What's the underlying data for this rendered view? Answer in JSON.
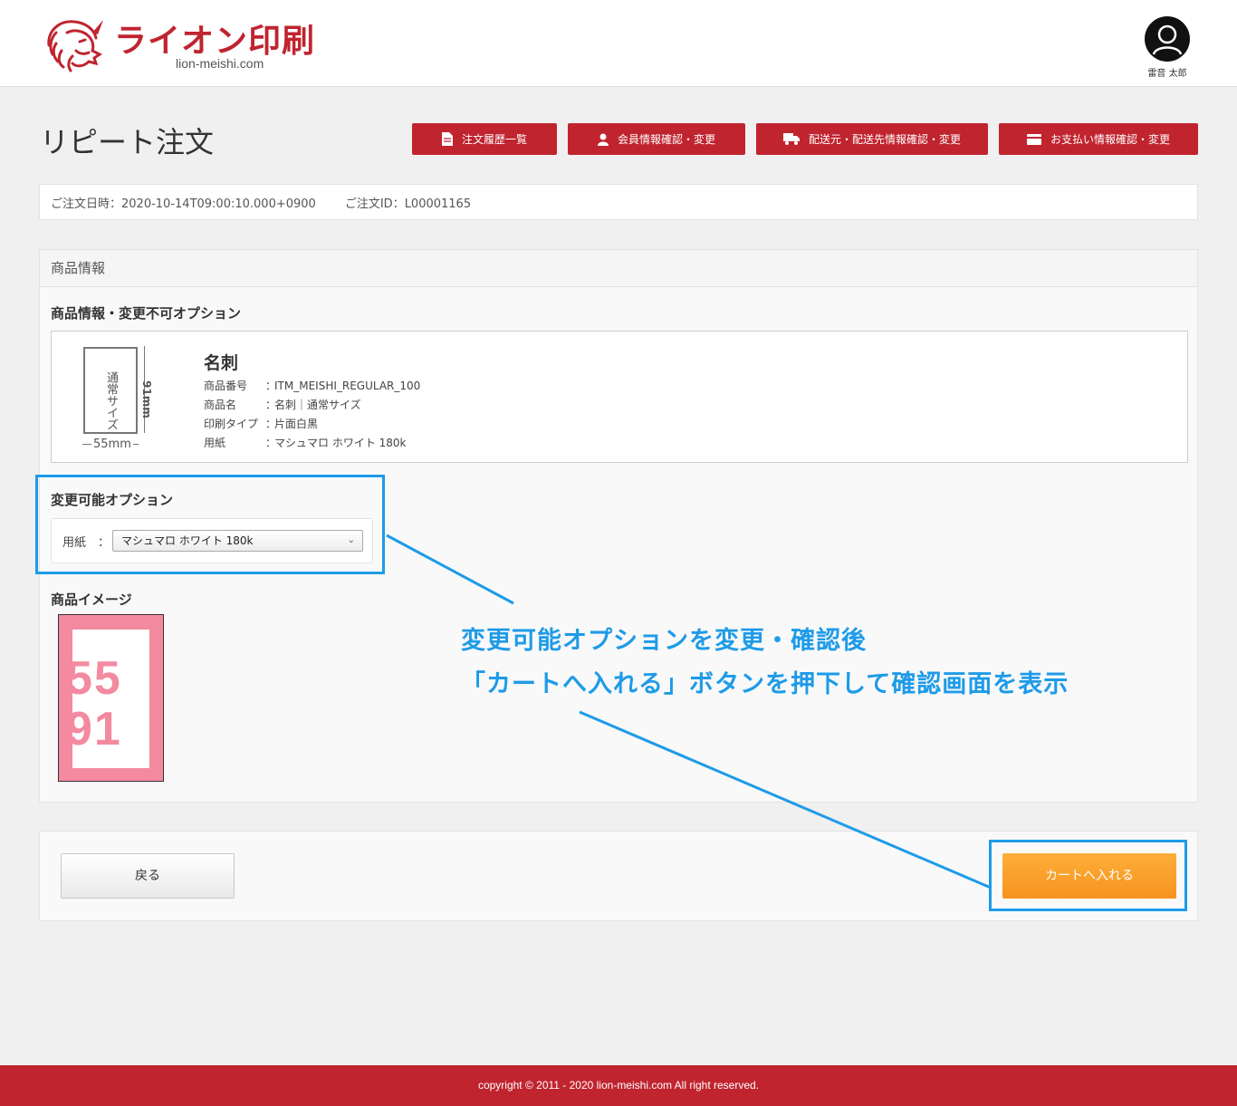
{
  "header": {
    "logo_title": "ライオン印刷",
    "logo_sub": "lion-meishi.com",
    "user_name": "雷音 太郎"
  },
  "page": {
    "title": "リピート注文"
  },
  "nav": {
    "order_history": "注文履歴一覧",
    "member_info": "会員情報確認・変更",
    "shipping_info": "配送元・配送先情報確認・変更",
    "payment_info": "お支払い情報確認・変更"
  },
  "order": {
    "date_label": "ご注文日時：",
    "date_value": "2020-10-14T09:00:10.000+0900",
    "id_label": "ご注文ID：",
    "id_value": "L00001165"
  },
  "product_panel": {
    "heading": "商品情報",
    "fixed_title": "商品情報・変更不可オプション",
    "card_label": "通常サイズ",
    "height_label": "91mm",
    "width_label": "55mm",
    "name": "名刺",
    "specs": [
      {
        "key": "商品番号",
        "sep": "：",
        "value": "ITM_MEISHI_REGULAR_100"
      },
      {
        "key": "商品名",
        "sep": "：",
        "value": "名刺｜通常サイズ"
      },
      {
        "key": "印刷タイプ",
        "sep": "：",
        "value": "片面白黒"
      },
      {
        "key": "用紙",
        "sep": "：",
        "value": "マシュマロ ホワイト 180k"
      }
    ],
    "changeable_title": "変更可能オプション",
    "option_label": "用紙　：",
    "option_selected": "マシュマロ ホワイト 180k",
    "image_title": "商品イメージ",
    "image_num_top": "55",
    "image_num_bottom": "91"
  },
  "actions": {
    "back": "戻る",
    "cart": "カートへ入れる"
  },
  "annotation": {
    "line1": "変更可能オプションを変更・確認後",
    "line2": "「カートへ入れる」ボタンを押下して確認画面を表示"
  },
  "footer": {
    "copyright": "copyright © 2011 - 2020 lion-meishi.com All right reserved."
  },
  "colors": {
    "brand": "#c0242f",
    "accent_orange": "#f7931e",
    "annotation_blue": "#1e9be8",
    "image_pink": "#f38aa0"
  }
}
